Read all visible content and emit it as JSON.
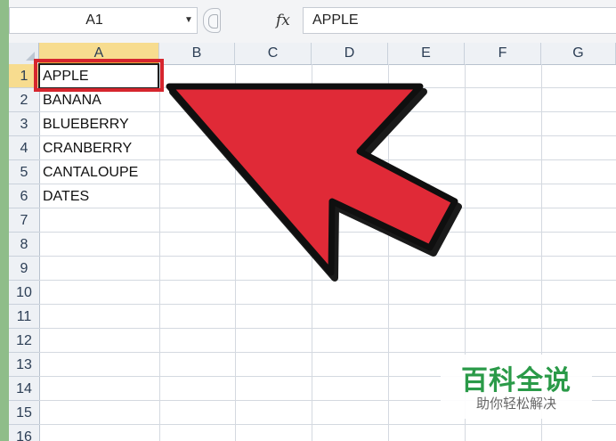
{
  "formula_bar": {
    "name_box": "A1",
    "dropdown_icon": "▼",
    "fx_label": "fx",
    "formula_value": "APPLE"
  },
  "columns": [
    "A",
    "B",
    "C",
    "D",
    "E",
    "F",
    "G"
  ],
  "rows": [
    "1",
    "2",
    "3",
    "4",
    "5",
    "6",
    "7",
    "8",
    "9",
    "10",
    "11",
    "12",
    "13",
    "14",
    "15",
    "16"
  ],
  "cells": {
    "A1": "APPLE",
    "A2": "BANANA",
    "A3": "BLUEBERRY",
    "A4": "CRANBERRY",
    "A5": "CANTALOUPE",
    "A6": "DATES"
  },
  "annotation": {
    "arrow_icon": "pointer-arrow-icon",
    "arrow_color": "#e02a37",
    "highlight_color": "#d6262e"
  },
  "watermark": {
    "title": "百科全说",
    "subtitle": "助你轻松解决"
  }
}
